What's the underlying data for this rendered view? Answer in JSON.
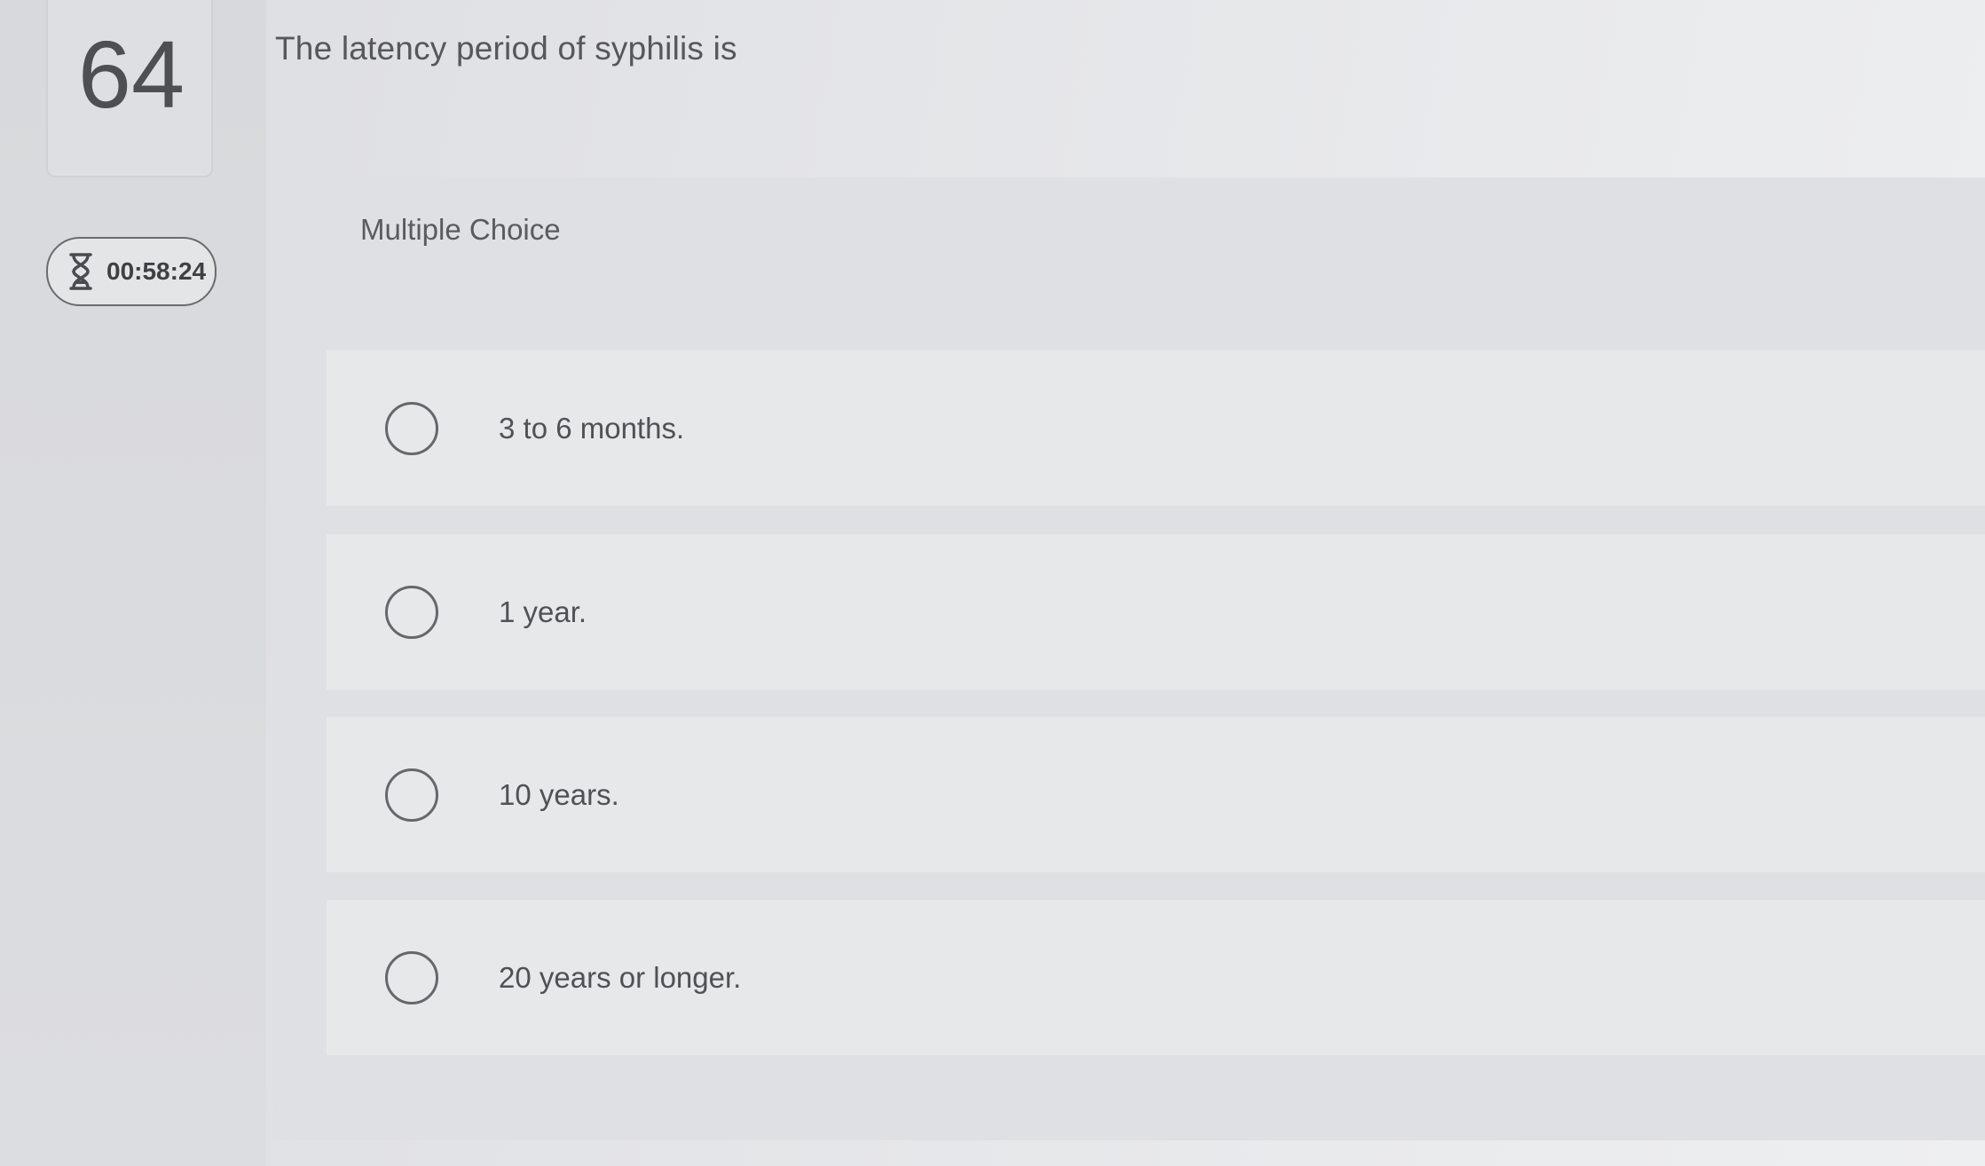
{
  "question": {
    "number": "64",
    "text": "The latency period of syphilis is",
    "type_label": "Multiple Choice"
  },
  "timer": {
    "icon": "hourglass-icon",
    "value": "00:58:24"
  },
  "options": [
    {
      "label": "3 to 6 months."
    },
    {
      "label": "1 year."
    },
    {
      "label": "10 years."
    },
    {
      "label": "20 years or longer."
    }
  ]
}
